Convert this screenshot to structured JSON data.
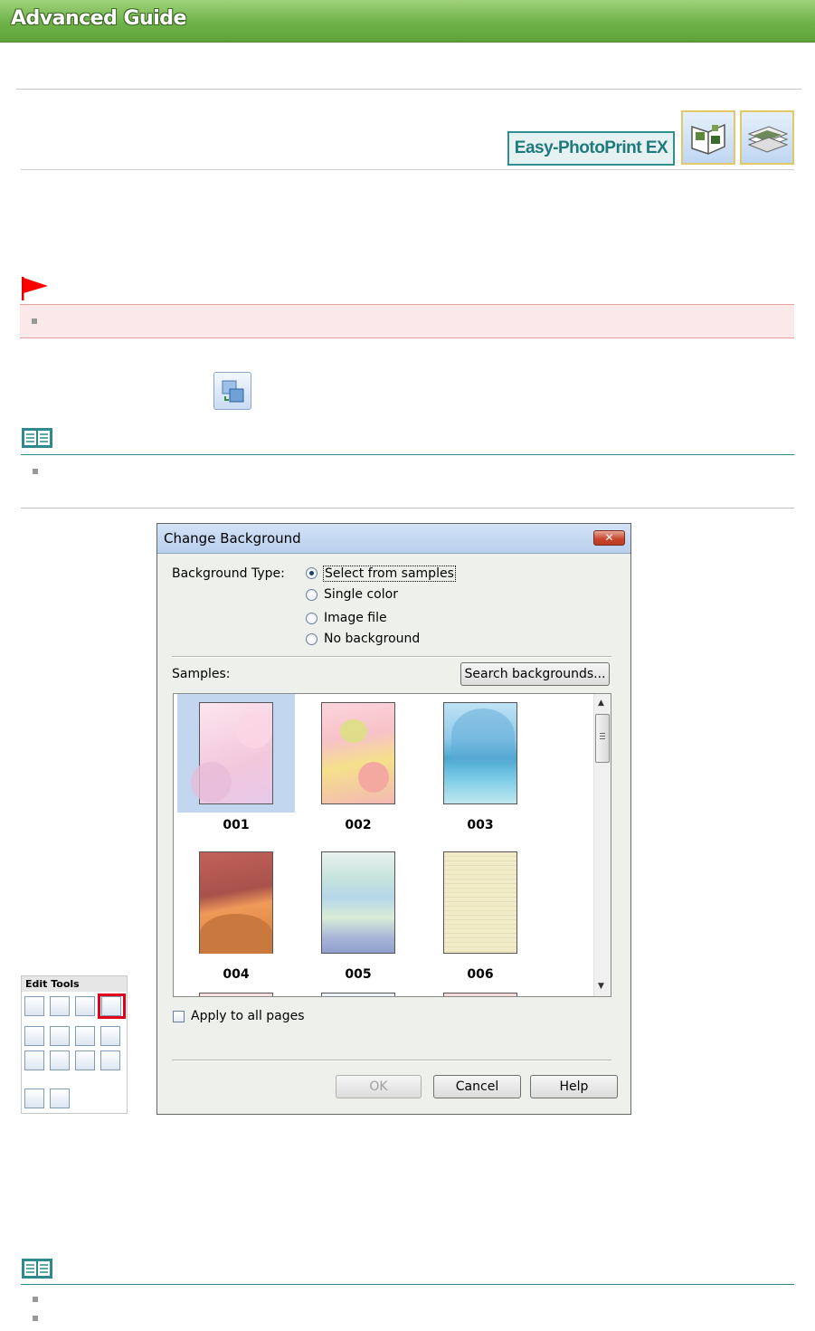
{
  "header": {
    "title": "Advanced Guide"
  },
  "app_badge": {
    "label": "Easy-PhotoPrint EX"
  },
  "icons": {
    "badge_icons": [
      "album-icon",
      "layout-print-icon"
    ],
    "important": "red-flag-icon",
    "note": "book-icon",
    "tool": "change-background-icon"
  },
  "edit_tools": {
    "title": "Edit Tools"
  },
  "dialog": {
    "title": "Change Background",
    "close_label": "✕",
    "background_type_label": "Background Type:",
    "options": [
      "Select from samples",
      "Single color",
      "Image file",
      "No background"
    ],
    "selected_option": "Select from samples",
    "samples_label": "Samples:",
    "search_button": "Search backgrounds...",
    "samples": [
      "001",
      "002",
      "003",
      "004",
      "005",
      "006"
    ],
    "apply_all_label": "Apply to all pages",
    "ok_button": "OK",
    "cancel_button": "Cancel",
    "help_button": "Help"
  },
  "colors": {
    "header_green": "#6fb24a",
    "badge_teal": "#2f8f91",
    "important_bg": "#fbe8e8",
    "note_line": "#2e8a8c",
    "selection": "#c2d6ef"
  }
}
